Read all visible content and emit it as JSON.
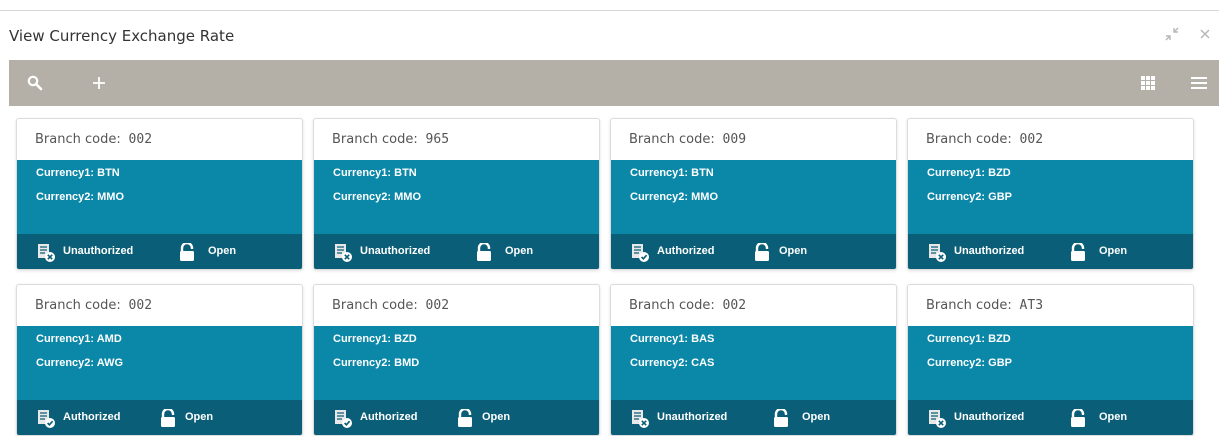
{
  "window": {
    "title": "View Currency Exchange Rate"
  },
  "toolbar": {},
  "labels": {
    "branch": "Branch code:",
    "cur1": "Currency1:",
    "cur2": "Currency2:"
  },
  "colors": {
    "toolbar": "#b4b0a8",
    "card_body": "#0b87a8",
    "card_footer": "#0a5e77"
  },
  "cards": [
    {
      "branch_code": "002",
      "currency1": "BTN",
      "currency2": "MMO",
      "auth_status": "Unauthorized",
      "record_status": "Open"
    },
    {
      "branch_code": "965",
      "currency1": "BTN",
      "currency2": "MMO",
      "auth_status": "Unauthorized",
      "record_status": "Open"
    },
    {
      "branch_code": "009",
      "currency1": "BTN",
      "currency2": "MMO",
      "auth_status": "Authorized",
      "record_status": "Open"
    },
    {
      "branch_code": "002",
      "currency1": "BZD",
      "currency2": "GBP",
      "auth_status": "Unauthorized",
      "record_status": "Open"
    },
    {
      "branch_code": "002",
      "currency1": "AMD",
      "currency2": "AWG",
      "auth_status": "Authorized",
      "record_status": "Open"
    },
    {
      "branch_code": "002",
      "currency1": "BZD",
      "currency2": "BMD",
      "auth_status": "Authorized",
      "record_status": "Open"
    },
    {
      "branch_code": "002",
      "currency1": "BAS",
      "currency2": "CAS",
      "auth_status": "Unauthorized",
      "record_status": "Open"
    },
    {
      "branch_code": "AT3",
      "currency1": "BZD",
      "currency2": "GBP",
      "auth_status": "Unauthorized",
      "record_status": "Open"
    }
  ]
}
